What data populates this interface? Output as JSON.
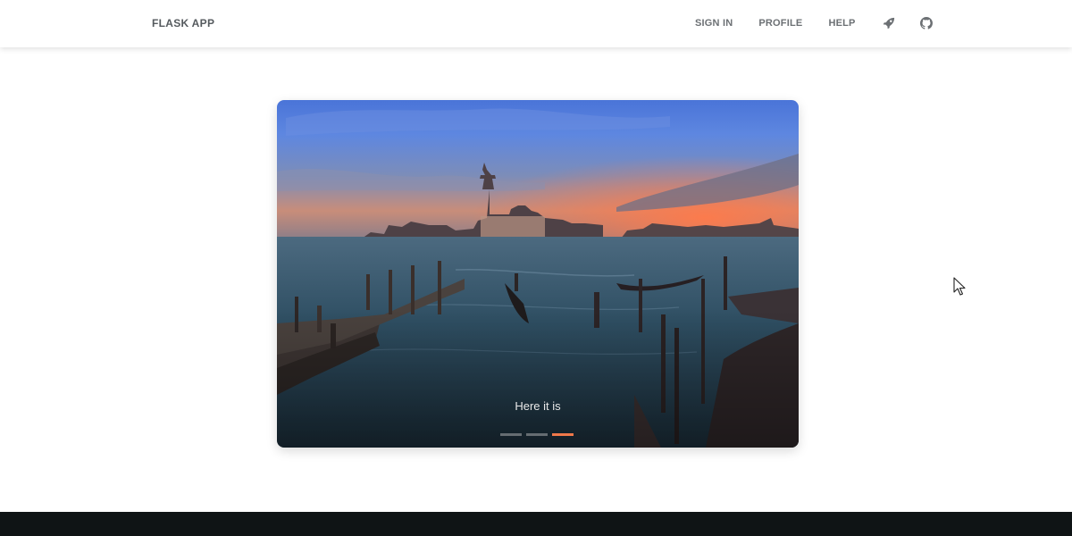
{
  "navbar": {
    "brand": "FLASK APP",
    "links": [
      "SIGN IN",
      "PROFILE",
      "HELP"
    ],
    "icons": [
      "rocket-icon",
      "github-icon"
    ]
  },
  "carousel": {
    "caption": "Here it is",
    "indicator_count": 3,
    "active_index": 2,
    "accent_color": "#f0784a"
  },
  "footer": {
    "color": "#0f1415"
  }
}
